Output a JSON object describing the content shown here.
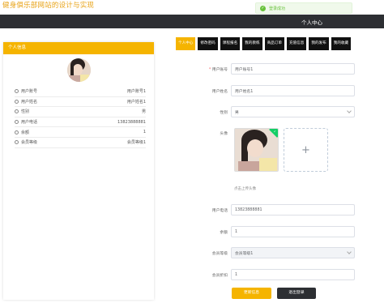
{
  "site_title": "健身俱乐部网站的设计与实现",
  "toast": {
    "message": "登录成功"
  },
  "header": {
    "title": "个人中心"
  },
  "left_panel": {
    "heading": "个人信息",
    "rows": [
      {
        "label": "用户账号",
        "value": "用户账号1"
      },
      {
        "label": "用户姓名",
        "value": "用户姓名1"
      },
      {
        "label": "性别",
        "value": "男"
      },
      {
        "label": "用户电话",
        "value": "13823888881"
      },
      {
        "label": "余额",
        "value": "1"
      },
      {
        "label": "会员等级",
        "value": "会员等级1"
      }
    ]
  },
  "tabs": [
    {
      "label": "个人中心",
      "active": true
    },
    {
      "label": "修改密码"
    },
    {
      "label": "课程报名"
    },
    {
      "label": "我的教练"
    },
    {
      "label": "商品订单"
    },
    {
      "label": "充值信息"
    },
    {
      "label": "我的发布"
    },
    {
      "label": "我的收藏"
    }
  ],
  "form": {
    "account": {
      "label": "用户账号",
      "value": "用户账号1"
    },
    "name": {
      "label": "用户姓名",
      "value": "用户姓名1"
    },
    "gender": {
      "label": "性别",
      "value": "男"
    },
    "avatar": {
      "label": "头像",
      "hint": "点击上传头像"
    },
    "phone": {
      "label": "用户电话",
      "value": "13823888881"
    },
    "balance": {
      "label": "余额",
      "value": "1"
    },
    "level": {
      "label": "会员等级",
      "value": "会员等级1"
    },
    "discount": {
      "label": "会员折扣",
      "value": "1"
    }
  },
  "buttons": {
    "save": "更新信息",
    "logout": "退出登录"
  }
}
